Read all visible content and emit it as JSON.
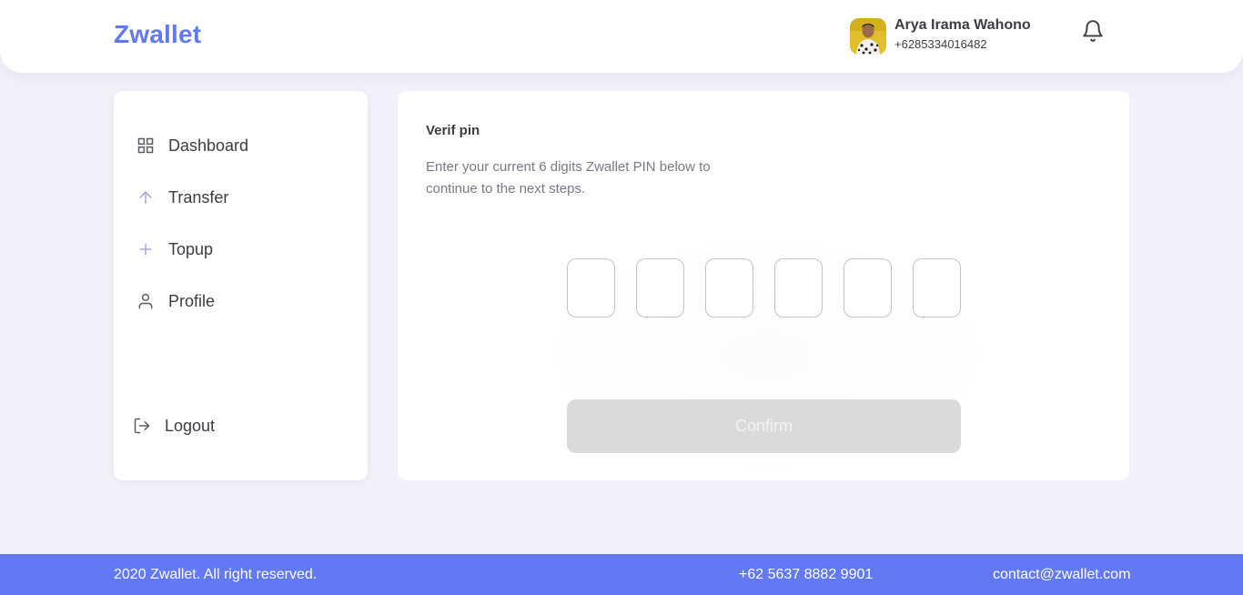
{
  "header": {
    "brand": "Zwallet",
    "user": {
      "name": "Arya Irama Wahono",
      "phone": "+6285334016482"
    },
    "icons": {
      "avatar": "user-avatar-photo",
      "notification": "bell-icon"
    }
  },
  "sidebar": {
    "items": [
      {
        "label": "Dashboard",
        "icon": "grid-icon"
      },
      {
        "label": "Transfer",
        "icon": "arrow-up-icon"
      },
      {
        "label": "Topup",
        "icon": "plus-icon"
      },
      {
        "label": "Profile",
        "icon": "user-icon"
      }
    ],
    "logout": {
      "label": "Logout",
      "icon": "logout-icon"
    }
  },
  "main": {
    "title": "Verif pin",
    "description": "Enter your current 6 digits Zwallet PIN below to continue to the next steps.",
    "pin_values": [
      "",
      "",
      "",
      "",
      "",
      ""
    ],
    "confirm_label": "Confirm"
  },
  "footer": {
    "copyright": "2020 Zwallet. All right reserved.",
    "phone": "+62 5637 8882 9901",
    "email": "contact@zwallet.com"
  },
  "colors": {
    "brand": "#6379f4",
    "background": "#f1f0fb",
    "text_primary": "#3a3d42",
    "text_secondary": "#7a7886",
    "button_disabled": "#dadada"
  }
}
